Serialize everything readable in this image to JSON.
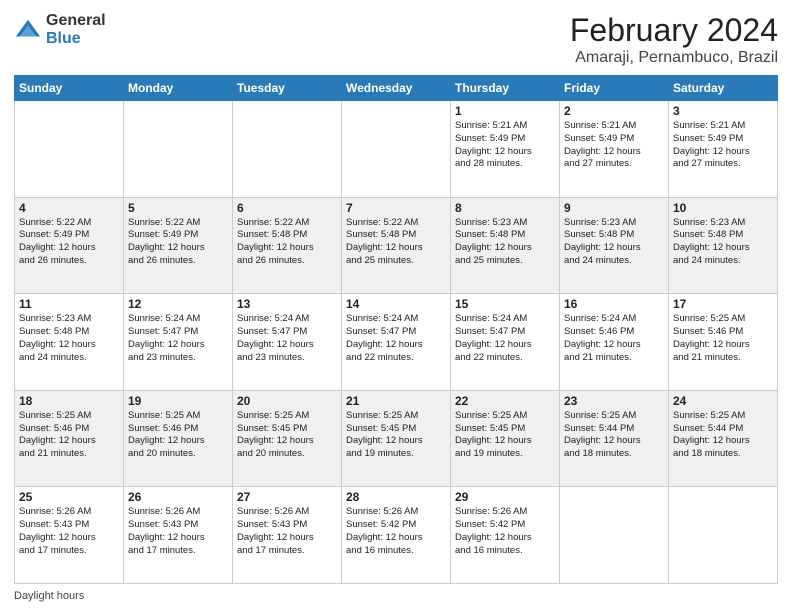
{
  "logo": {
    "general": "General",
    "blue": "Blue"
  },
  "title": {
    "month_year": "February 2024",
    "location": "Amaraji, Pernambuco, Brazil"
  },
  "days_of_week": [
    "Sunday",
    "Monday",
    "Tuesday",
    "Wednesday",
    "Thursday",
    "Friday",
    "Saturday"
  ],
  "weeks": [
    [
      {
        "day": "",
        "info": ""
      },
      {
        "day": "",
        "info": ""
      },
      {
        "day": "",
        "info": ""
      },
      {
        "day": "",
        "info": ""
      },
      {
        "day": "1",
        "info": "Sunrise: 5:21 AM\nSunset: 5:49 PM\nDaylight: 12 hours\nand 28 minutes."
      },
      {
        "day": "2",
        "info": "Sunrise: 5:21 AM\nSunset: 5:49 PM\nDaylight: 12 hours\nand 27 minutes."
      },
      {
        "day": "3",
        "info": "Sunrise: 5:21 AM\nSunset: 5:49 PM\nDaylight: 12 hours\nand 27 minutes."
      }
    ],
    [
      {
        "day": "4",
        "info": "Sunrise: 5:22 AM\nSunset: 5:49 PM\nDaylight: 12 hours\nand 26 minutes."
      },
      {
        "day": "5",
        "info": "Sunrise: 5:22 AM\nSunset: 5:49 PM\nDaylight: 12 hours\nand 26 minutes."
      },
      {
        "day": "6",
        "info": "Sunrise: 5:22 AM\nSunset: 5:48 PM\nDaylight: 12 hours\nand 26 minutes."
      },
      {
        "day": "7",
        "info": "Sunrise: 5:22 AM\nSunset: 5:48 PM\nDaylight: 12 hours\nand 25 minutes."
      },
      {
        "day": "8",
        "info": "Sunrise: 5:23 AM\nSunset: 5:48 PM\nDaylight: 12 hours\nand 25 minutes."
      },
      {
        "day": "9",
        "info": "Sunrise: 5:23 AM\nSunset: 5:48 PM\nDaylight: 12 hours\nand 24 minutes."
      },
      {
        "day": "10",
        "info": "Sunrise: 5:23 AM\nSunset: 5:48 PM\nDaylight: 12 hours\nand 24 minutes."
      }
    ],
    [
      {
        "day": "11",
        "info": "Sunrise: 5:23 AM\nSunset: 5:48 PM\nDaylight: 12 hours\nand 24 minutes."
      },
      {
        "day": "12",
        "info": "Sunrise: 5:24 AM\nSunset: 5:47 PM\nDaylight: 12 hours\nand 23 minutes."
      },
      {
        "day": "13",
        "info": "Sunrise: 5:24 AM\nSunset: 5:47 PM\nDaylight: 12 hours\nand 23 minutes."
      },
      {
        "day": "14",
        "info": "Sunrise: 5:24 AM\nSunset: 5:47 PM\nDaylight: 12 hours\nand 22 minutes."
      },
      {
        "day": "15",
        "info": "Sunrise: 5:24 AM\nSunset: 5:47 PM\nDaylight: 12 hours\nand 22 minutes."
      },
      {
        "day": "16",
        "info": "Sunrise: 5:24 AM\nSunset: 5:46 PM\nDaylight: 12 hours\nand 21 minutes."
      },
      {
        "day": "17",
        "info": "Sunrise: 5:25 AM\nSunset: 5:46 PM\nDaylight: 12 hours\nand 21 minutes."
      }
    ],
    [
      {
        "day": "18",
        "info": "Sunrise: 5:25 AM\nSunset: 5:46 PM\nDaylight: 12 hours\nand 21 minutes."
      },
      {
        "day": "19",
        "info": "Sunrise: 5:25 AM\nSunset: 5:46 PM\nDaylight: 12 hours\nand 20 minutes."
      },
      {
        "day": "20",
        "info": "Sunrise: 5:25 AM\nSunset: 5:45 PM\nDaylight: 12 hours\nand 20 minutes."
      },
      {
        "day": "21",
        "info": "Sunrise: 5:25 AM\nSunset: 5:45 PM\nDaylight: 12 hours\nand 19 minutes."
      },
      {
        "day": "22",
        "info": "Sunrise: 5:25 AM\nSunset: 5:45 PM\nDaylight: 12 hours\nand 19 minutes."
      },
      {
        "day": "23",
        "info": "Sunrise: 5:25 AM\nSunset: 5:44 PM\nDaylight: 12 hours\nand 18 minutes."
      },
      {
        "day": "24",
        "info": "Sunrise: 5:25 AM\nSunset: 5:44 PM\nDaylight: 12 hours\nand 18 minutes."
      }
    ],
    [
      {
        "day": "25",
        "info": "Sunrise: 5:26 AM\nSunset: 5:43 PM\nDaylight: 12 hours\nand 17 minutes."
      },
      {
        "day": "26",
        "info": "Sunrise: 5:26 AM\nSunset: 5:43 PM\nDaylight: 12 hours\nand 17 minutes."
      },
      {
        "day": "27",
        "info": "Sunrise: 5:26 AM\nSunset: 5:43 PM\nDaylight: 12 hours\nand 17 minutes."
      },
      {
        "day": "28",
        "info": "Sunrise: 5:26 AM\nSunset: 5:42 PM\nDaylight: 12 hours\nand 16 minutes."
      },
      {
        "day": "29",
        "info": "Sunrise: 5:26 AM\nSunset: 5:42 PM\nDaylight: 12 hours\nand 16 minutes."
      },
      {
        "day": "",
        "info": ""
      },
      {
        "day": "",
        "info": ""
      }
    ]
  ],
  "footer": {
    "label": "Daylight hours"
  }
}
